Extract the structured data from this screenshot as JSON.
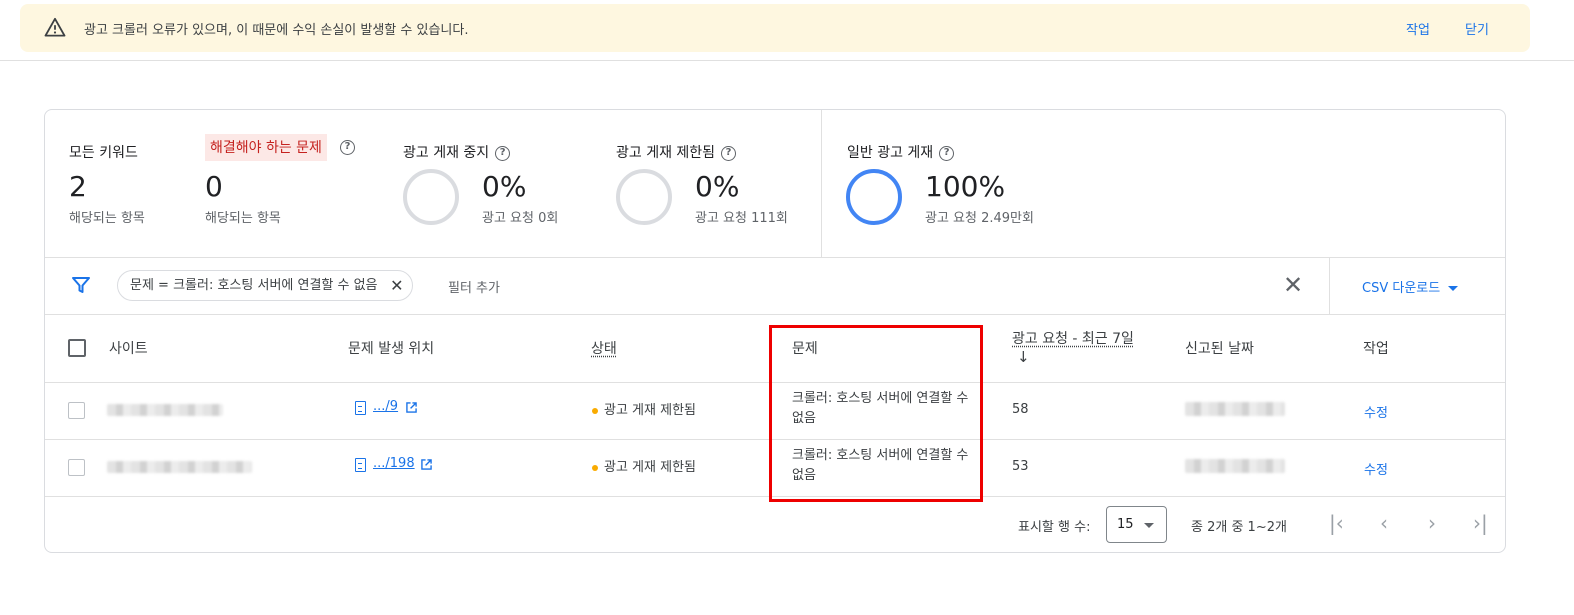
{
  "banner": {
    "message": "광고 크롤러 오류가 있으며, 이 때문에 수익 손실이 발생할 수 있습니다.",
    "action_label": "작업",
    "close_label": "닫기"
  },
  "stats": {
    "all_keywords": {
      "label": "모든 키워드",
      "value": "2",
      "sub": "해당되는 항목"
    },
    "issues": {
      "label": "해결해야 하는 문제",
      "value": "0",
      "sub": "해당되는 항목"
    },
    "stopped": {
      "label": "광고 게재 중지",
      "value": "0%",
      "sub": "광고 요청 0회",
      "fraction": 0
    },
    "limited": {
      "label": "광고 게재 제한됨",
      "value": "0%",
      "sub": "광고 요청 111회",
      "fraction": 0
    },
    "normal": {
      "label": "일반 광고 게재",
      "value": "100%",
      "sub": "광고 요청 2.49만회",
      "fraction": 1
    }
  },
  "filter": {
    "chip_label": "문제 = 크롤러: 호스팅 서버에 연결할 수 없음",
    "add_filter_label": "필터 추가",
    "csv_label": "CSV 다운로드"
  },
  "table": {
    "headers": {
      "site": "사이트",
      "location": "문제 발생 위치",
      "status": "상태",
      "issue": "문제",
      "requests": "광고 요청 - 최근 7일",
      "sort_arrow": "↓",
      "reported": "신고된 날짜",
      "action": "작업"
    },
    "rows": [
      {
        "location": ".../9",
        "status": "광고 게재 제한됨",
        "issue": "크롤러: 호스팅 서버에 연결할 수 없음",
        "requests": "58",
        "action": "수정"
      },
      {
        "location": ".../198",
        "status": "광고 게재 제한됨",
        "issue": "크롤러: 호스팅 서버에 연결할 수 없음",
        "requests": "53",
        "action": "수정"
      }
    ]
  },
  "footer": {
    "rows_label": "표시할 행 수:",
    "rows_value": "15",
    "range_label": "종 2개 중 1~2개"
  },
  "colors": {
    "accent": "#1a73e8",
    "warning_bg": "#fef7e0",
    "issue_chip_bg": "#fce8e6",
    "issue_chip_text": "#c5221f",
    "limited_dot": "#f9ab00",
    "ring_full": "#4285f4",
    "highlight_box": "#ee0000"
  },
  "icons": {
    "banner": "warning-triangle-icon",
    "help": "help-circle-icon",
    "filter": "filter-icon",
    "doc": "document-icon",
    "external": "open-in-new-icon"
  }
}
